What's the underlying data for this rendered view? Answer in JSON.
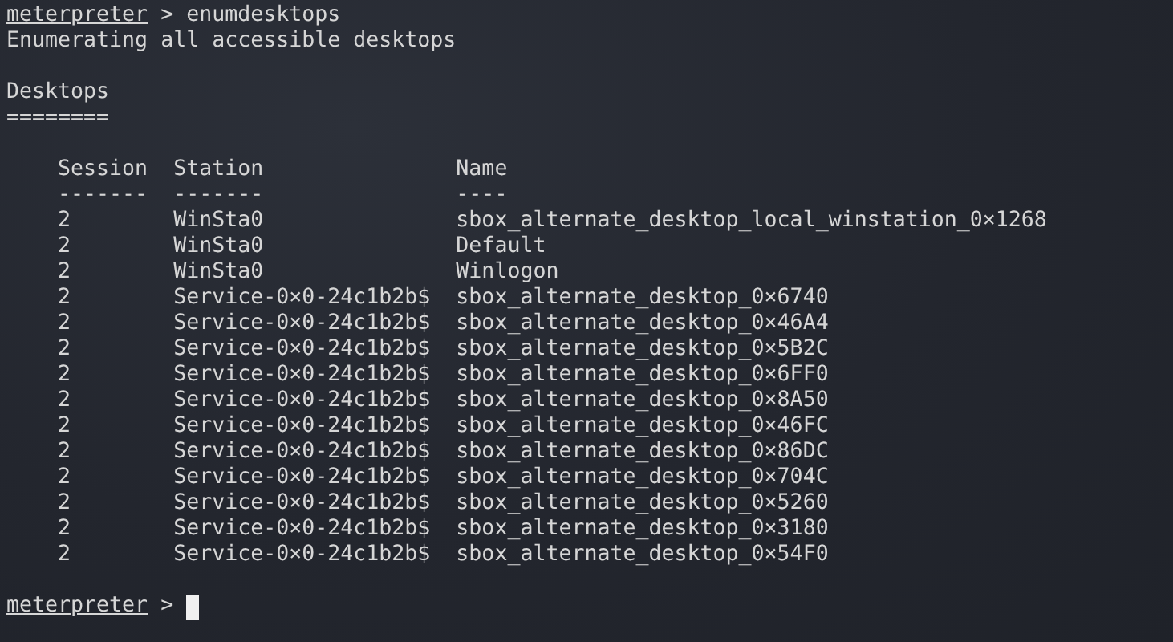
{
  "terminal": {
    "lines": [
      {
        "kind": "prompt",
        "prompt": "meterpreter",
        "separator": ">",
        "command": "enumdesktops"
      },
      {
        "kind": "text",
        "text": "Enumerating all accessible desktops"
      },
      {
        "kind": "blank"
      },
      {
        "kind": "text",
        "text": "Desktops"
      },
      {
        "kind": "text",
        "text": "========"
      },
      {
        "kind": "blank"
      }
    ],
    "table": {
      "columns": [
        {
          "label": "Session",
          "rule": "-------"
        },
        {
          "label": "Station",
          "rule": "-------"
        },
        {
          "label": "Name",
          "rule": "----"
        }
      ],
      "rows": [
        [
          "2",
          "WinSta0",
          "sbox_alternate_desktop_local_winstation_0×1268"
        ],
        [
          "2",
          "WinSta0",
          "Default"
        ],
        [
          "2",
          "WinSta0",
          "Winlogon"
        ],
        [
          "2",
          "Service-0×0-24c1b2b$",
          "sbox_alternate_desktop_0×6740"
        ],
        [
          "2",
          "Service-0×0-24c1b2b$",
          "sbox_alternate_desktop_0×46A4"
        ],
        [
          "2",
          "Service-0×0-24c1b2b$",
          "sbox_alternate_desktop_0×5B2C"
        ],
        [
          "2",
          "Service-0×0-24c1b2b$",
          "sbox_alternate_desktop_0×6FF0"
        ],
        [
          "2",
          "Service-0×0-24c1b2b$",
          "sbox_alternate_desktop_0×8A50"
        ],
        [
          "2",
          "Service-0×0-24c1b2b$",
          "sbox_alternate_desktop_0×46FC"
        ],
        [
          "2",
          "Service-0×0-24c1b2b$",
          "sbox_alternate_desktop_0×86DC"
        ],
        [
          "2",
          "Service-0×0-24c1b2b$",
          "sbox_alternate_desktop_0×704C"
        ],
        [
          "2",
          "Service-0×0-24c1b2b$",
          "sbox_alternate_desktop_0×5260"
        ],
        [
          "2",
          "Service-0×0-24c1b2b$",
          "sbox_alternate_desktop_0×3180"
        ],
        [
          "2",
          "Service-0×0-24c1b2b$",
          "sbox_alternate_desktop_0×54F0"
        ]
      ]
    },
    "final_prompt": {
      "prompt": "meterpreter",
      "separator": ">",
      "cursor": true
    }
  }
}
